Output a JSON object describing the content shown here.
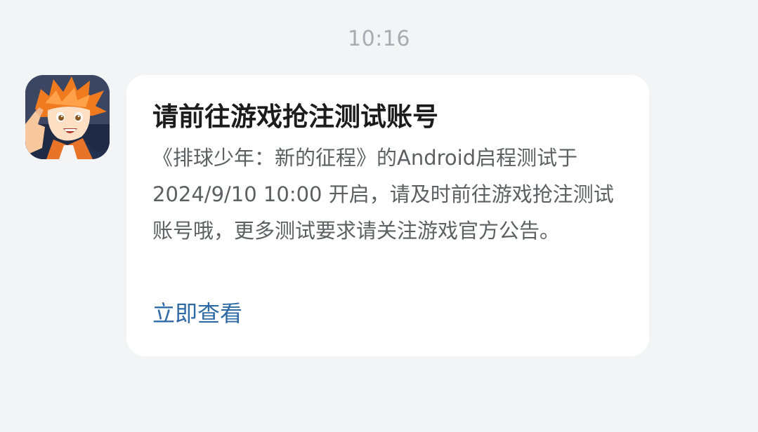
{
  "chat": {
    "timestamp": "10:16"
  },
  "message": {
    "sender_avatar_icon": "game-app-icon",
    "title": "请前往游戏抢注测试账号",
    "body": "《排球少年：新的征程》的Android启程测试于 2024/9/10 10:00 开启，请及时前往游戏抢注测试账号哦，更多测试要求请关注游戏官方公告。",
    "link_label": "立即查看"
  },
  "colors": {
    "background": "#f3f4f6",
    "card": "#ffffff",
    "title": "#1c1c1c",
    "body": "#5d5f63",
    "link": "#2e6aa6",
    "timestamp": "#a7abb2"
  }
}
